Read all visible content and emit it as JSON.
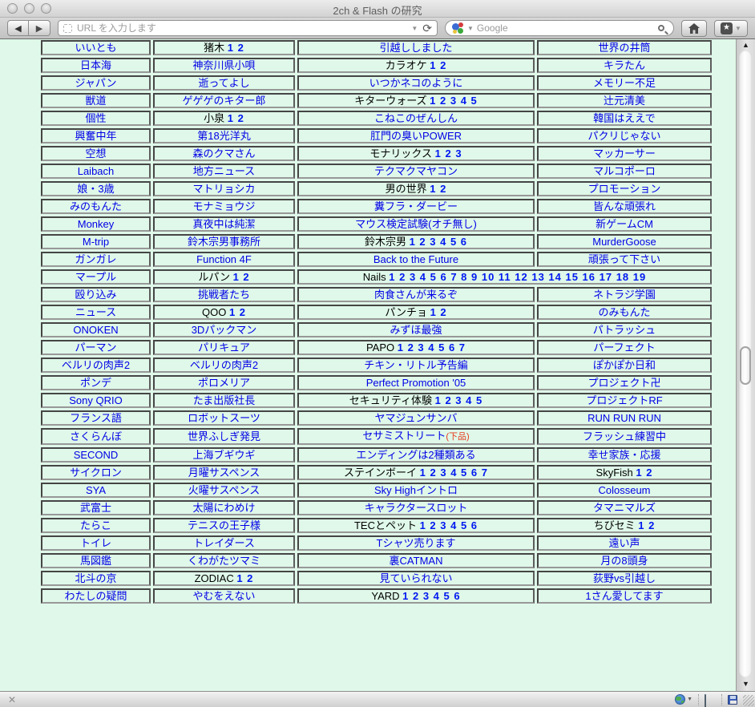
{
  "window": {
    "title": "2ch & Flash の研究"
  },
  "toolbar": {
    "back_glyph": "◀",
    "forward_glyph": "▶",
    "url_placeholder": "URL を入力します",
    "url_dropdown_glyph": "▼",
    "reload_glyph": "⟳",
    "search_placeholder": "Google",
    "search_dropdown_glyph": "▼",
    "bookmark_star_glyph": "★",
    "bookmark_dropdown_glyph": "▼",
    "home_glyph": "⌂"
  },
  "scrollbar": {
    "up_glyph": "▲",
    "down_glyph": "▼"
  },
  "statusbar": {
    "close_glyph": "✕",
    "globe_dropdown_glyph": "▼"
  },
  "colors": {
    "page_background": "#dff8e9",
    "link_blue": "#0000e6",
    "number_link_blue": "#0018f0",
    "plain_title_black": "#000000",
    "warning_red": "#e8391c"
  },
  "table": {
    "rows": [
      [
        {
          "t": "いいとも"
        },
        {
          "p": "猪木",
          "n": "1 2"
        },
        {
          "t": "引越ししました"
        },
        {
          "t": "世界の井筒"
        }
      ],
      [
        {
          "t": "日本海"
        },
        {
          "t": "神奈川県小唄"
        },
        {
          "p": "カラオケ",
          "n": "1 2"
        },
        {
          "t": "キラたん"
        }
      ],
      [
        {
          "t": "ジャパン"
        },
        {
          "t": "逝ってよし"
        },
        {
          "t": "いつかネコのように"
        },
        {
          "t": "メモリー不足"
        }
      ],
      [
        {
          "t": "獣道"
        },
        {
          "t": "ゲゲゲのキター郎"
        },
        {
          "p": "キターウォーズ",
          "n": "1 2 3 4 5"
        },
        {
          "t": "辻元清美"
        }
      ],
      [
        {
          "t": "個性"
        },
        {
          "p": "小泉",
          "n": "1 2"
        },
        {
          "t": "こねこのぜんしん"
        },
        {
          "t": "韓国はええで"
        }
      ],
      [
        {
          "t": "興奮中年"
        },
        {
          "t": "第18光洋丸"
        },
        {
          "t": "肛門の臭いPOWER"
        },
        {
          "t": "パクリじゃない"
        }
      ],
      [
        {
          "t": "空想"
        },
        {
          "t": "森のクマさん"
        },
        {
          "p": "モナリックス",
          "n": "1 2 3"
        },
        {
          "t": "マッカーサー"
        }
      ],
      [
        {
          "t": "Laibach"
        },
        {
          "t": "地方ニュース"
        },
        {
          "t": "テクマクマヤコン"
        },
        {
          "t": "マルコポーロ"
        }
      ],
      [
        {
          "t": "娘・3歳"
        },
        {
          "t": "マトリョシカ"
        },
        {
          "p": "男の世界",
          "n": "1 2"
        },
        {
          "t": "プロモーション"
        }
      ],
      [
        {
          "t": "みのもんた"
        },
        {
          "t": "モナミョウジ"
        },
        {
          "t": "糞フラ・ダービー"
        },
        {
          "t": "皆んな頑張れ"
        }
      ],
      [
        {
          "t": "Monkey"
        },
        {
          "t": "真夜中は純潔"
        },
        {
          "t": "マウス検定試験(オチ無し)"
        },
        {
          "t": "新ゲームCM"
        }
      ],
      [
        {
          "t": "M-trip"
        },
        {
          "t": "鈴木宗男事務所"
        },
        {
          "p": "鈴木宗男",
          "n": "1 2 3 4 5 6"
        },
        {
          "t": "MurderGoose"
        }
      ],
      [
        {
          "t": "ガンガレ"
        },
        {
          "t": "Function 4F"
        },
        {
          "t": "Back to the Future"
        },
        {
          "t": "頑張って下さい"
        }
      ],
      [
        {
          "t": "マープル"
        },
        {
          "p": "ルパン",
          "n": "1 2"
        },
        {
          "p": "Nails",
          "n": "1 2 3 4 5 6 7 8 9 10 11 12 13 14 15 16 17 18 19",
          "cs": 2
        }
      ],
      [
        {
          "t": "殴り込み"
        },
        {
          "t": "挑戦者たち"
        },
        {
          "t": "肉食さんが来るぞ"
        },
        {
          "t": "ネトラジ学園"
        }
      ],
      [
        {
          "t": "ニュース"
        },
        {
          "p": "QOO",
          "n": "1 2"
        },
        {
          "p": "パンチョ",
          "n": "1 2"
        },
        {
          "t": "のみもんた"
        }
      ],
      [
        {
          "t": "ONOKEN"
        },
        {
          "t": "3Dパックマン"
        },
        {
          "t": "みずほ最強"
        },
        {
          "t": "パトラッシュ"
        }
      ],
      [
        {
          "t": "パーマン"
        },
        {
          "t": "パリキュア"
        },
        {
          "p": "PAPO",
          "n": "1 2 3 4 5 6 7"
        },
        {
          "t": "パーフェクト"
        }
      ],
      [
        {
          "t": "ベルリの肉声2"
        },
        {
          "t": "ベルリの肉声2"
        },
        {
          "t": "チキン・リトル予告編"
        },
        {
          "t": "ぽかぽか日和"
        }
      ],
      [
        {
          "t": "ポンデ"
        },
        {
          "t": "ポロメリア"
        },
        {
          "t": "Perfect Promotion '05"
        },
        {
          "t": "プロジェクト卍"
        }
      ],
      [
        {
          "t": "Sony QRIO"
        },
        {
          "t": "たま出版社長"
        },
        {
          "p": "セキュリティ体験",
          "n": "1 2 3 4 5"
        },
        {
          "t": "プロジェクトRF"
        }
      ],
      [
        {
          "t": "フランス語"
        },
        {
          "t": "ロボットスーツ"
        },
        {
          "t": "ヤマジュンサンバ"
        },
        {
          "t": "RUN RUN RUN"
        }
      ],
      [
        {
          "t": "さくらんぼ"
        },
        {
          "t": "世界ふしぎ発見"
        },
        {
          "t": "セサミストリート",
          "r": "(下品)"
        },
        {
          "t": "フラッシュ練習中"
        }
      ],
      [
        {
          "t": "SECOND"
        },
        {
          "t": "上海ブギウギ"
        },
        {
          "t": "エンディングは2種類ある"
        },
        {
          "t": "幸せ家族・応援"
        }
      ],
      [
        {
          "t": "サイクロン"
        },
        {
          "t": "月曜サスペンス"
        },
        {
          "p": "ステインボーイ",
          "n": "1 2 3 4 5 6 7"
        },
        {
          "p": "SkyFish",
          "n": "1 2"
        }
      ],
      [
        {
          "t": "SYA"
        },
        {
          "t": "火曜サスペンス"
        },
        {
          "t": "Sky Highイントロ"
        },
        {
          "t": "Colosseum"
        }
      ],
      [
        {
          "t": "武富士"
        },
        {
          "t": "太陽にわめけ"
        },
        {
          "t": "キャラクタースロット"
        },
        {
          "t": "タマニマルズ"
        }
      ],
      [
        {
          "t": "たらこ"
        },
        {
          "t": "テニスの王子様"
        },
        {
          "p": "TECとペット",
          "n": "1 2 3 4 5 6"
        },
        {
          "p": "ちびセミ",
          "n": "1 2"
        }
      ],
      [
        {
          "t": "トイレ"
        },
        {
          "t": "トレイダース"
        },
        {
          "t": "Tシャツ売ります"
        },
        {
          "t": "遠い声"
        }
      ],
      [
        {
          "t": "馬図鑑"
        },
        {
          "t": "くわがたツマミ"
        },
        {
          "t": "裏CATMAN"
        },
        {
          "t": "月の8頭身"
        }
      ],
      [
        {
          "t": "北斗の京"
        },
        {
          "p": "ZODIAC",
          "n": "1 2"
        },
        {
          "t": "見ていられない"
        },
        {
          "t": "荻野vs引越し"
        }
      ],
      [
        {
          "t": "わたしの疑問"
        },
        {
          "t": "やむをえない"
        },
        {
          "p": "YARD",
          "n": "1 2 3 4 5 6"
        },
        {
          "t": "1さん愛してます"
        }
      ]
    ]
  }
}
